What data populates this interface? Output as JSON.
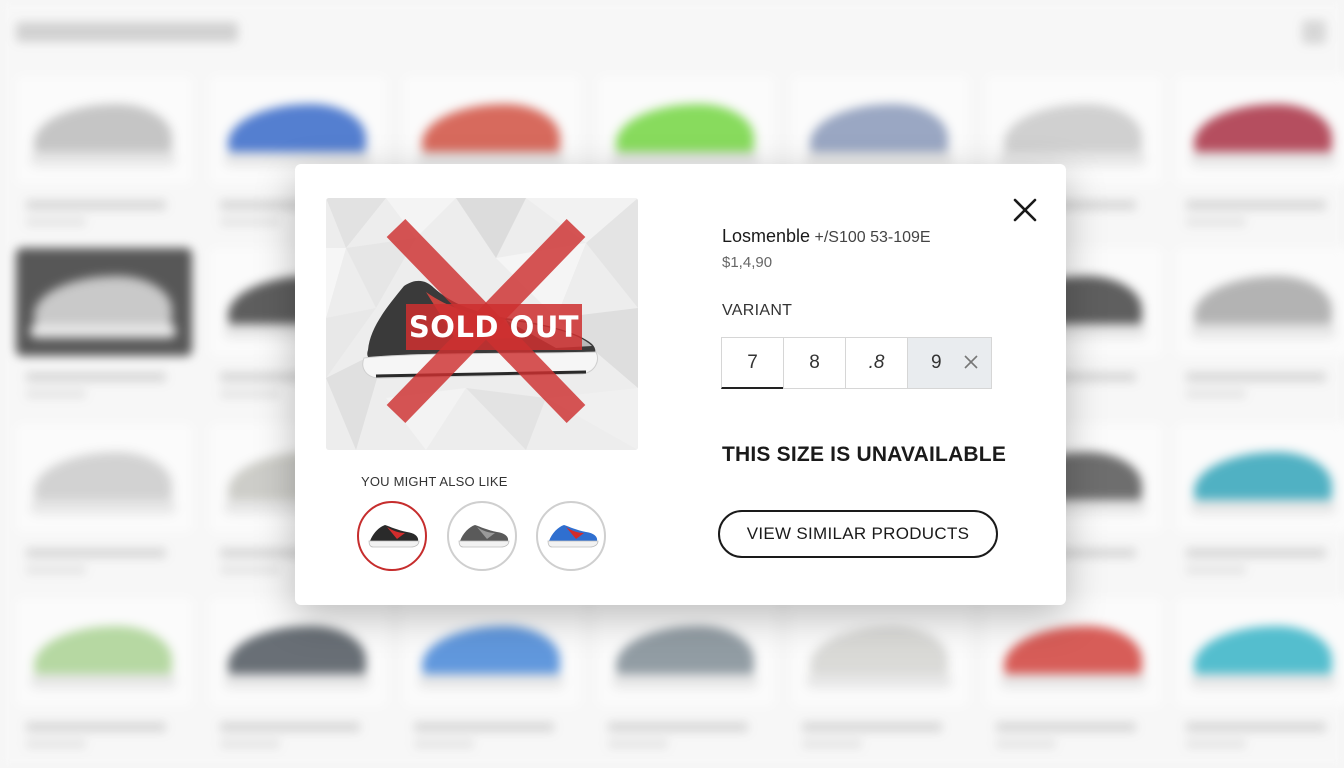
{
  "background": {
    "header_blurred": true,
    "grid_shoe_colors": [
      [
        "#b9b9b9",
        "#2f63c6",
        "#cf4a3a",
        "#6ed43a",
        "#8494b6",
        "#c6c6c6",
        "#a5283c"
      ],
      [
        "#bdbdbd",
        "#3b3b3b",
        null,
        null,
        null,
        "#3c3c3c",
        "#a3a3a3"
      ],
      [
        "#c9c9c9",
        "#c3c3bd",
        null,
        null,
        null,
        "#4f4f4f",
        "#2aa0b6"
      ],
      [
        "#a6d08e",
        "#485058",
        "#3f82d6",
        "#7b8891",
        "#d2d2cf",
        "#cf3a34",
        "#2fb0c4"
      ]
    ]
  },
  "modal": {
    "close_icon": "close-icon",
    "product": {
      "title": "Losmenble",
      "sku": " +/S100 53-109E",
      "price": "$1,4,90",
      "image_badge": "SOLD OUT",
      "badge_color": "#cd3030"
    },
    "recommendations": {
      "label": "YOU MIGHT ALSO LIKE",
      "items": [
        {
          "icon": "black-red-shoe-icon",
          "accent": "#d22c2c",
          "body": "#2a2a2a",
          "selected": true
        },
        {
          "icon": "grey-shoe-icon",
          "accent": "#9a9a9a",
          "body": "#5a5a5a",
          "selected": false
        },
        {
          "icon": "blue-red-shoe-icon",
          "accent": "#d22c2c",
          "body": "#2f6fd0",
          "selected": false
        }
      ]
    },
    "variant": {
      "label": "VARIANT",
      "options": [
        {
          "label": "7",
          "state": "selected"
        },
        {
          "label": "8",
          "state": "available"
        },
        {
          "label": ".8",
          "state": "available"
        },
        {
          "label": "9",
          "state": "unavailable"
        }
      ]
    },
    "message": "THIS SIZE IS UNAVAILABLE",
    "cta": "VIEW SIMILAR PRODUCTS"
  }
}
